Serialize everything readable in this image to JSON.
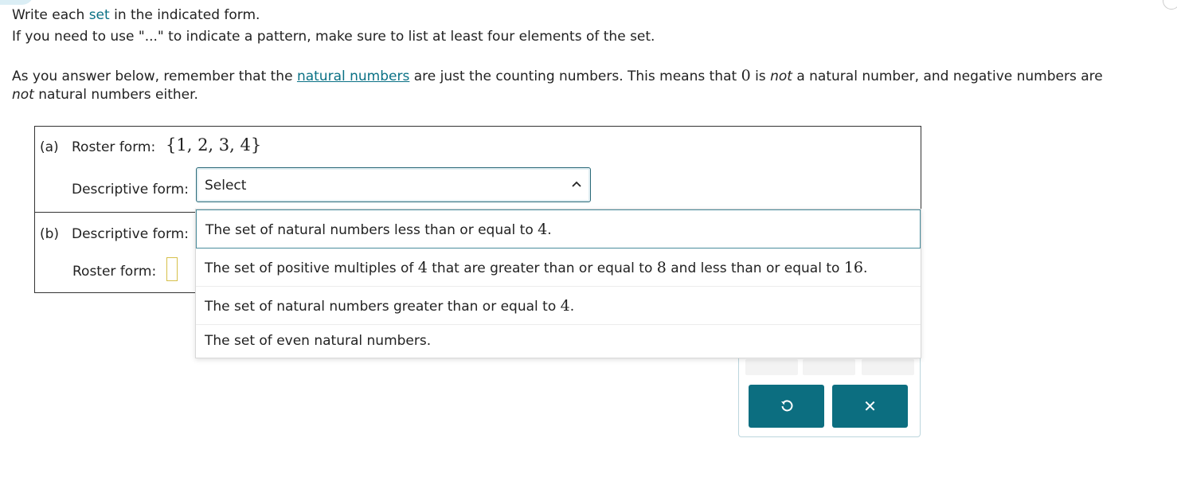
{
  "instructions": {
    "line1_before": "Write each",
    "line1_link": "set",
    "line1_after": "in the indicated form.",
    "line2": "If you need to use \"...\" to indicate a pattern, make sure to list at least four elements of the set.",
    "line3_before": "As you answer below, remember that the",
    "line3_link": "natural numbers",
    "line3_mid": "are just the counting numbers. This means that",
    "line3_zero": "0",
    "line3_is": "is",
    "line3_not": "not",
    "line3_after": "a natural number, and negative numbers are",
    "line4_not": "not",
    "line4_after": "natural numbers either."
  },
  "part_a": {
    "label": "(a)",
    "roster_label": "Roster form:",
    "roster_value": "{1, 2, 3, 4}",
    "descriptive_label": "Descriptive form:",
    "select_value": "Select"
  },
  "part_b": {
    "label": "(b)",
    "descriptive_label": "Descriptive form:",
    "roster_label": "Roster form:"
  },
  "dropdown": {
    "options": [
      {
        "pre": "The set of natural numbers less than or equal to",
        "n1": "4",
        "mid": "",
        "n2": "",
        "post": "."
      },
      {
        "pre": "The set of positive multiples of",
        "n1": "4",
        "mid": "that are greater than or equal to",
        "n2": "8",
        "mid2": "and less than or equal to",
        "n3": "16",
        "post": "."
      },
      {
        "pre": "The set of natural numbers greater than or equal to",
        "n1": "4",
        "post": "."
      },
      {
        "pre": "The set of even natural numbers.",
        "n1": "",
        "post": ""
      }
    ]
  },
  "keypad": {
    "reset_icon": "undo-icon",
    "close_icon": "close-icon",
    "close_glyph": "✕",
    "accent": "#0c6e80"
  }
}
